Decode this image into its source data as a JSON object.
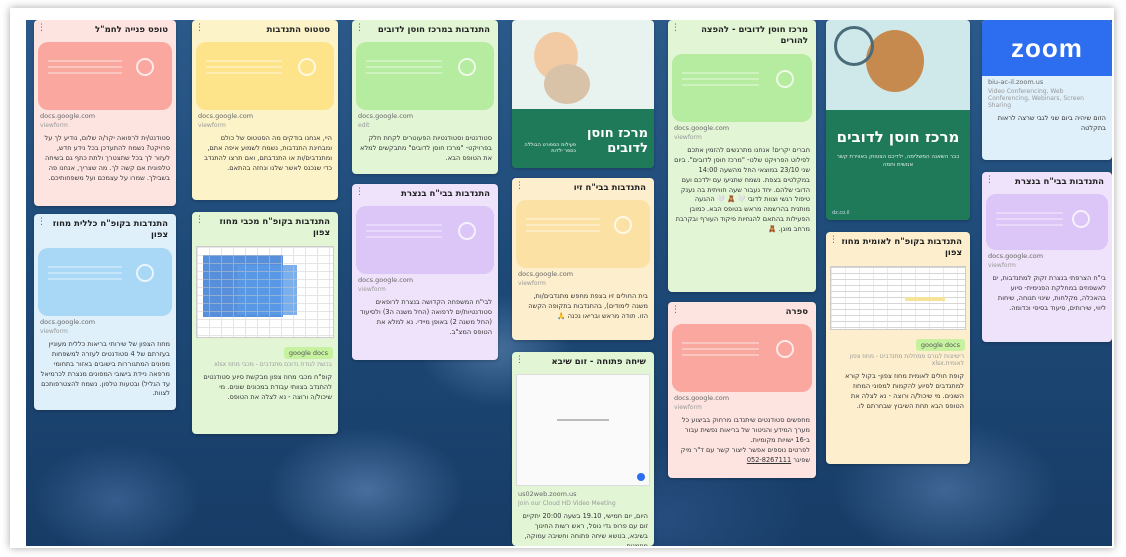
{
  "cards": {
    "c1": {
      "title": "טופס פנייה לחמ\"ל",
      "domain": "docs.google.com",
      "via": "viewform",
      "body": "סטודנט/ית לרפואה יקר/ה שלום, נודיע לך על פרויקט? נשמח להתעדכן בכל נידע חדש, לעזור לך בכל שתצטרך ולתת כתף גם בשיחה טלפונית אם קשה לך. מה שצריך, אנחנו פה בשבילך. שמרו על עצמכם ועל משפחותיכם."
    },
    "c2": {
      "title": "התנדבות בקופ\"ח כללית מחוז צפון",
      "domain": "docs.google.com",
      "via": "viewform",
      "body": "מחוז הצפון של שירותי בריאות כללית מעוניין בעזרתם של 4 סטודנטים לעזרה למשפחות מפונים המתגוררות בישובים באזור בתחומי מרפאה ניידת בישובי המפונים מנצרת לכרמיאל עד הגליל) ובטעות טלפון. נשמח להצטרפותכם לצוות."
    },
    "c3": {
      "title": "סטטוס התנדבות",
      "domain": "docs.google.com",
      "via": "viewform",
      "body": "היי, אנחנו בודקים מה הסטטוס של כולם ומבחינת התנדבות, נשמח לשמוע איפה אתם, ומתנדבים/ות או התנדבתם, ואם תרצו להתנדב כדי שנכנס לאשר שלנו ונחזה בהתאם."
    },
    "c4": {
      "title": "התנדבות בקופ\"ח מכבי מחוז צפון",
      "tag": "google docs",
      "sheet_caption": "בכשת לגודת נדוכם מתנדבים - מכבי מחוז xlsx",
      "body": "קופ\"ח מכבי מחוז צפון מבקשת סיוע סטודנטים להתנדב בצוותי עבודת במכונים שונים. מי שיכול/ה ורוצה - נא לצלה את הטופס."
    },
    "c5": {
      "title": "התנדבות במרכז חוסן לדובים",
      "domain": "docs.google.com",
      "via": "edit",
      "body": "סטודנטים וסטודנטיות הפעוטרים לקחת חלק בפרויקט- \"מרכז חוסן לדובים\" מתבקשים למלא את הטופס הבא."
    },
    "c6": {
      "title": "התנדבות בבי\"ח בנצרת",
      "domain": "docs.google.com",
      "via": "viewform",
      "body": "לבי\"ח המשפחה הקדושה בנצרת לרופאים סטודנטיות/ים לרפואה (החל משנה ה3) ולסיעוד (החל משנה 2) באופן מיידי. נא למלא את הטופס המצ\"ב."
    },
    "c7": {
      "poster_title": "מרכז חוסן לדובים",
      "poster_sub": "פעילות הספורט הבוללה כספר ילדות"
    },
    "c8": {
      "title": "התנדבות בבי\"ח זיו",
      "domain": "docs.google.com",
      "via": "viewform",
      "body": "בית החולים זיו בצפת מחפש מתנדבים/ות, משנה לימודים), בהתנדבות בתקופה הקשה הזו. תודה מראש ובריאו נכנה 🙏"
    },
    "c9": {
      "title": "שיחה פתוחה - זום שיבא",
      "domain": "us02web.zoom.us",
      "via": "Join our Cloud HD Video Meeting",
      "body": "היום, יום חמישי, 19.10 בשעה 20:00 יתקיים זום עם פרופ גדי נוסל, ראש רשות החינוך בשיבא, בנושא שיחה פתוחה וחשיבה עמוקה, מוזמנים."
    },
    "c10": {
      "title": "מרכז חוסן לדובים - להפצה להורים",
      "domain": "docs.google.com",
      "via": "viewform",
      "body": "חברים יקרים! אנחנו מתרגשים להזמין אתכם לפילוט הפרויקט שלנו- \"מרכז חוסן לדובים\". ביום שני 23/10 במוצאי החל מהשעה 14:00 במקלטים בצפת. נשמח שתגיעו עם ילדכם ועם הדובי שלהם. יחד נעבור שעה חוויתית בה נענק טיפול רגשי וצוות לדובי 🤍 🧸 🤍 ההגעה מותנית בהרשמה מראש בטופס הבא. כמובן הפעילות בהתאם להנחיות פיקוד העורף ובקרבת מרחב מוגן. 🧸"
    },
    "c11": {
      "title": "ספרה",
      "domain": "docs.google.com",
      "via": "viewform",
      "body": "מחפשים סטודנטים שיתנדבו מרחוק בביצוע כל מערך המידע והניטור של בריאות נפשית עבור ב-16 ישויות מקומיות.",
      "phone_line": "לפרטים נוספים אפשר ליצור קשר עם ד\"ר מיק שפיגר",
      "phone": "052-8267111"
    },
    "c12": {
      "poster_title": "מרכז חוסן לדובים",
      "poster_sub": "כבר השאנה המשלימה, ילדיכם הצטווק באווירת קשר אנושית וחמה",
      "domain": "dz.co.il"
    },
    "c13": {
      "title": "התנדבות בקופ\"ח לאומית מחוז צפון",
      "tag": "google docs",
      "sheet_caption": "רישיונות לגורם ממחלות מתנדבים - מחוז צפון לאומית.xlsx",
      "body": "קופת חולים לאומית מחוז צפון- בקול קורא למתנדבים לסיוע להקמות למפוני המחוז השונים. מי שיכול/ה ורוצה - נא לצלה את הטופס הבא תחת השיבוץ שבחרתם לו."
    },
    "c14": {
      "logo": "zoom",
      "domain": "biu-ac-il.zoom.us",
      "via": "Video Conferencing, Web Conferencing, Webinars, Screen Sharing",
      "body": "הזום שיהיה ביום שני לגבי שרצה לראות בתקלטה"
    },
    "c15": {
      "title": "התנדבות בבי\"ח בנצרת",
      "domain": "docs.google.com",
      "via": "viewform",
      "body": "בי\"ח הצרפתי בנצרת זקוק למתנדבות, ים לאשפוזים במחלקת הפנימית- סיוע בהאכלה, מקלחות, שינוי תנוחה, שיחות ליווי, שירותים, סיעוד בסיסי וכדומה."
    }
  },
  "colors": {
    "red": "#f9a79f",
    "yellow": "#fde38a",
    "green": "#b6eca0",
    "purple": "#dcc5f7",
    "blue": "#a9d7f6",
    "orange": "#fbe1a4"
  }
}
